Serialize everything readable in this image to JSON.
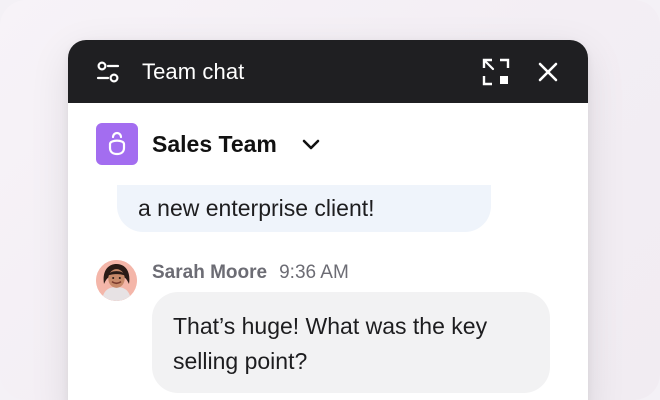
{
  "window": {
    "title": "Team chat",
    "icons": {
      "settings": "settings-icon",
      "expand": "expand-icon",
      "close": "close-icon"
    }
  },
  "channel": {
    "name": "Sales Team",
    "icon": "bag-icon",
    "dropdown_icon": "chevron-down-icon",
    "accent": "#a36df0"
  },
  "messages": [
    {
      "text": "a new enterprise client!",
      "bubble_color": "#eff4fb"
    },
    {
      "sender": "Sarah Moore",
      "time": "9:36 AM",
      "text": "That’s huge! What was the key selling point?",
      "bubble_color": "#f2f2f3",
      "avatar": "avatar"
    }
  ],
  "colors": {
    "titlebar_bg": "#1f1f22",
    "titlebar_text": "#ffffff",
    "panel_bg": "#ffffff"
  }
}
